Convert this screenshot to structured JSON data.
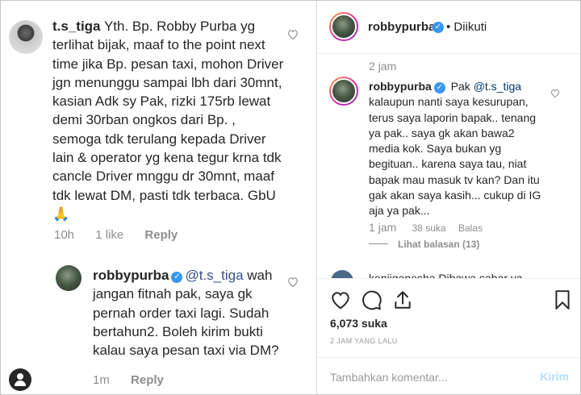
{
  "left_panel": {
    "main_comment": {
      "username": "t.s_tiga",
      "text": "Yth. Bp. Robby Purba yg terlihat bijak, maaf to the point next time jika Bp. pesan taxi, mohon Driver jgn menunggu sampai lbh dari 30mnt, kasian Adk sy Pak, rizki 175rb lewat demi 30rban ongkos dari Bp. , semoga tdk terulang kepada Driver lain & operator yg kena tegur krna tdk cancle Driver mnggu dr 30mnt, maaf tdk lewat DM, pasti tdk terbaca. GbU 🙏",
      "time": "10h",
      "likes": "1 like",
      "reply_label": "Reply"
    },
    "reply_comment": {
      "username": "robbypurba",
      "mention": "@t.s_tiga",
      "text": " wah jangan fitnah pak, saya gk pernah order taxi lagi. Sudah bertahun2. Boleh kirim bukti kalau saya pesan taxi via DM?",
      "time": "1m",
      "reply_label": "Reply"
    }
  },
  "right_panel": {
    "header": {
      "username": "robbypurba",
      "follow_status": "• Diikuti"
    },
    "top_time": "2 jam",
    "comment": {
      "username": "robbypurba",
      "mention": "@t.s_tiga",
      "prefix": " Pak ",
      "text": " kalaupun nanti saya kesurupan, terus saya laporin bapak.. tenang ya pak.. saya gk akan bawa2 media kok. Saya bukan yg begituan.. karena saya tau, niat bapak mau masuk tv kan? Dan itu gak akan saya kasih... cukup di IG aja ya pak...",
      "time": "1 jam",
      "likes": "38 suka",
      "reply_label": "Balas",
      "view_replies": "Lihat balasan (13)"
    },
    "peek_text": "kenjigenesha Dibawa sabar ya",
    "likes_count": "6,073 suka",
    "posted_ago": "2 JAM YANG LALU",
    "add_comment_placeholder": "Tambahkan komentar...",
    "post_label": "Kirim"
  },
  "colors": {
    "verified": "#3897f0",
    "link": "#385185",
    "muted": "#8e8e8e",
    "post_disabled": "#b2dffc"
  }
}
